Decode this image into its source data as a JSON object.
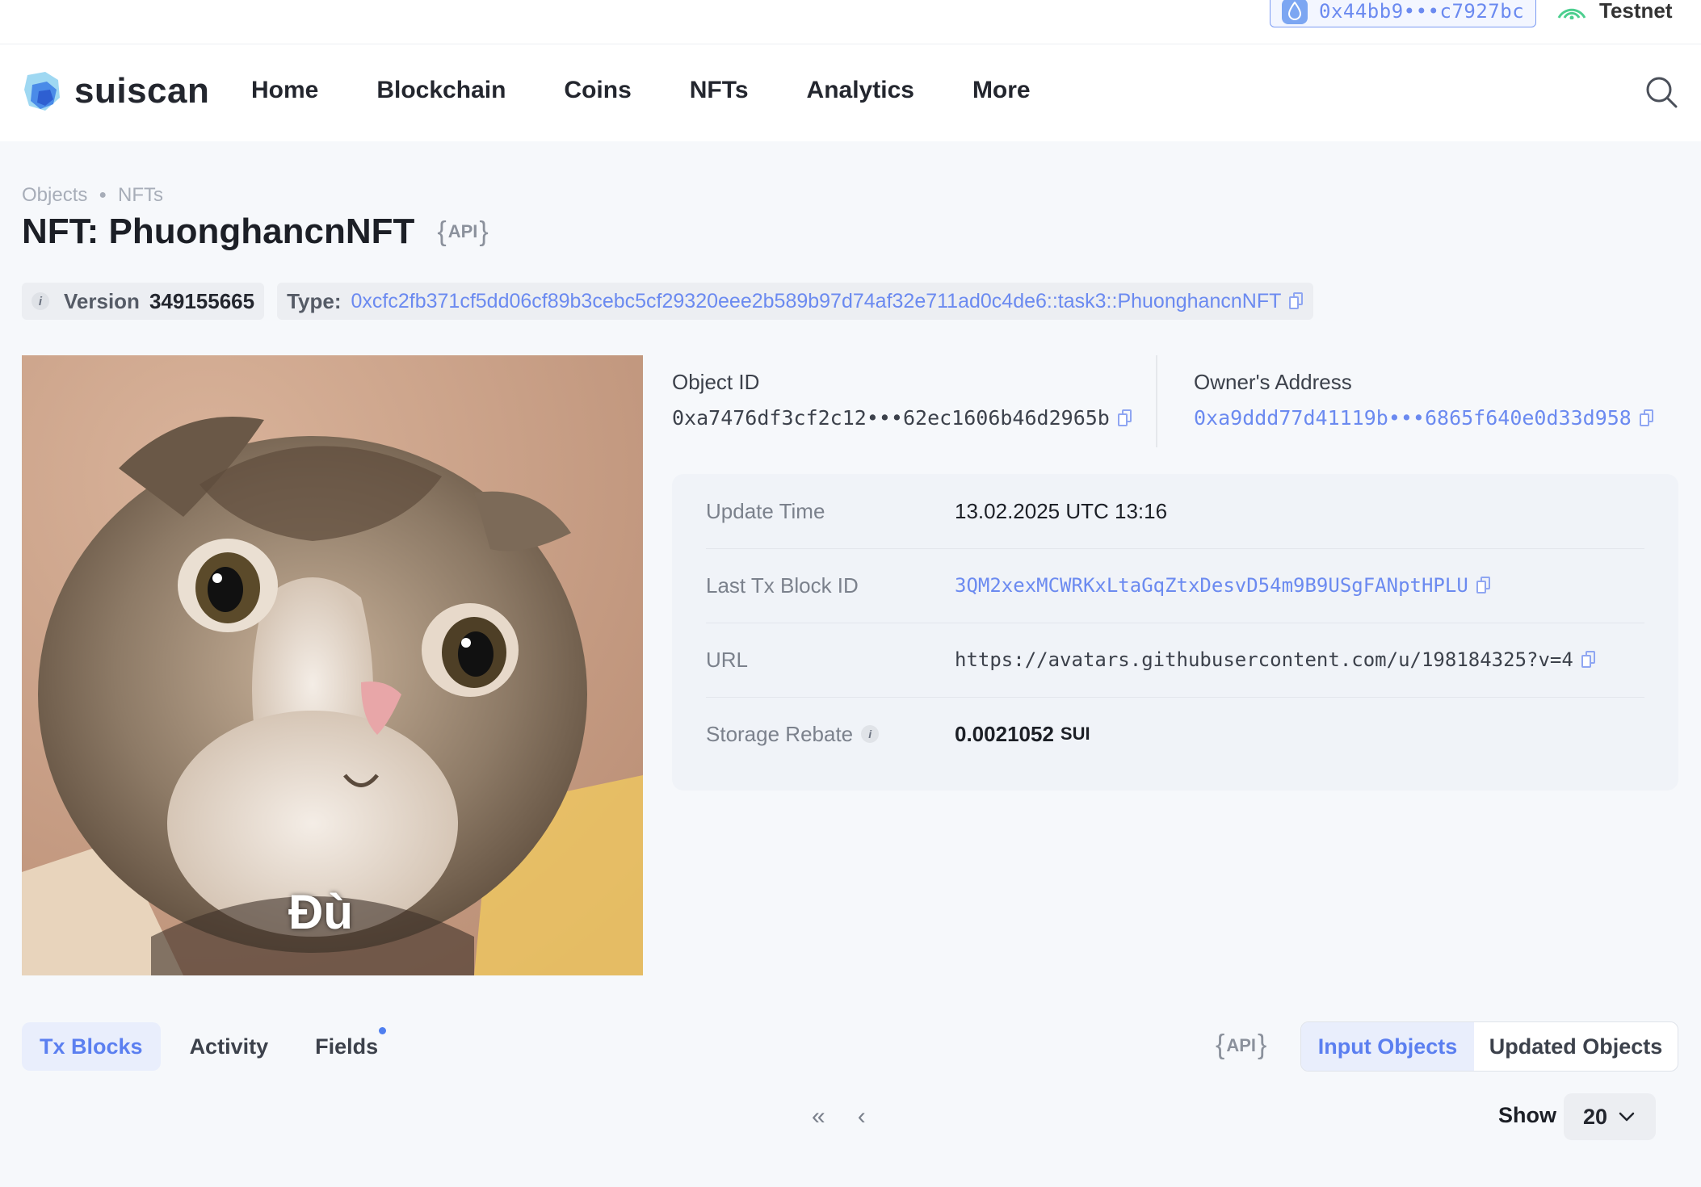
{
  "topbar": {
    "wallet_address": "0x44bb9•••c7927bc",
    "network": "Testnet"
  },
  "nav": {
    "brand": "suiscan",
    "items": [
      "Home",
      "Blockchain",
      "Coins",
      "NFTs",
      "Analytics",
      "More"
    ]
  },
  "breadcrumb": [
    "Objects",
    "NFTs"
  ],
  "page": {
    "title": "NFT: PhuonghancnNFT",
    "api_label": "API"
  },
  "chips": {
    "version_label": "Version",
    "version_value": "349155665",
    "type_label": "Type:",
    "type_value": "0xcfc2fb371cf5dd06cf89b3cebc5cf29320eee2b589b97d74af32e711ad0c4de6::task3::PhuonghancnNFT"
  },
  "image": {
    "caption_text": "Đù"
  },
  "object": {
    "object_id_label": "Object ID",
    "object_id_value": "0xa7476df3cf2c12•••62ec1606b46d2965b",
    "owner_label": "Owner's Address",
    "owner_value": "0xa9ddd77d41119b•••6865f640e0d33d958"
  },
  "details": [
    {
      "label": "Update Time",
      "value": "13.02.2025 UTC 13:16"
    },
    {
      "label": "Last Tx Block ID",
      "value": "3QM2xexMCWRKxLtaGqZtxDesvD54m9B9USgFANptHPLU"
    },
    {
      "label": "URL",
      "value": "https://avatars.githubusercontent.com/u/198184325?v=4"
    },
    {
      "label": "Storage Rebate",
      "value": "0.0021052",
      "unit": "SUI"
    }
  ],
  "tabs": [
    "Tx Blocks",
    "Activity",
    "Fields"
  ],
  "segmented": [
    "Input Objects",
    "Updated Objects"
  ],
  "pagination": {
    "first": "«",
    "prev": "‹",
    "show_label": "Show",
    "page_size": "20"
  },
  "colors": {
    "accent": "#6b8af0",
    "active_tab_bg": "#e9eefc",
    "page_bg": "#f6f8fb"
  }
}
